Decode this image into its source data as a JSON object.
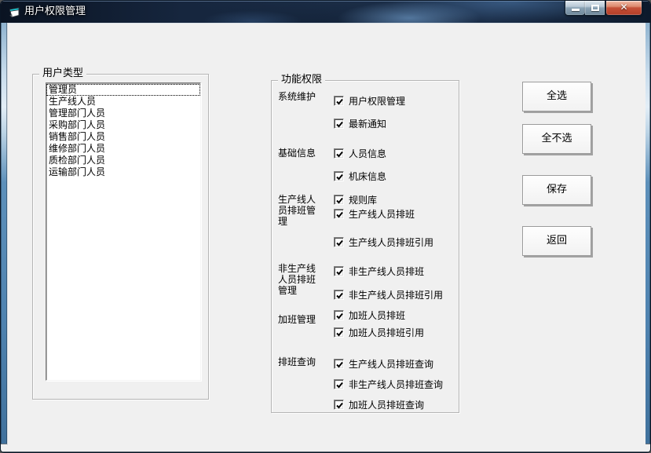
{
  "window": {
    "title": "用户权限管理"
  },
  "icons": {
    "close_glyph": "✕"
  },
  "colors": {
    "titlebar": "#1c2f4a",
    "frame_blue": "#5d90ba",
    "client_bg": "#f0f0f0",
    "close_button_red": "#c65138"
  },
  "user_types": {
    "group_label": "用户类型",
    "selected_index": 0,
    "items": [
      "管理员",
      "生产线人员",
      "管理部门人员",
      "采购部门人员",
      "销售部门人员",
      "维修部门人员",
      "质检部门人员",
      "运输部门人员"
    ]
  },
  "permissions": {
    "group_label": "功能权限",
    "sections": [
      {
        "label": "系统维护",
        "items": [
          {
            "label": "用户权限管理",
            "checked": true
          },
          {
            "label": "最新通知",
            "checked": true
          }
        ]
      },
      {
        "label": "基础信息",
        "items": [
          {
            "label": "人员信息",
            "checked": true
          },
          {
            "label": "机床信息",
            "checked": true
          }
        ]
      },
      {
        "label": "生产线人员排班管理",
        "items": [
          {
            "label": "规则库",
            "checked": true
          },
          {
            "label": "生产线人员排班",
            "checked": true
          },
          {
            "label": "生产线人员排班引用",
            "checked": true
          }
        ]
      },
      {
        "label": "非生产线人员排班管理",
        "items": [
          {
            "label": "非生产线人员排班",
            "checked": true
          },
          {
            "label": "非生产线人员排班引用",
            "checked": true
          }
        ]
      },
      {
        "label": "加班管理",
        "items": [
          {
            "label": "加班人员排班",
            "checked": true
          },
          {
            "label": "加班人员排班引用",
            "checked": true
          }
        ]
      },
      {
        "label": "排班查询",
        "items": [
          {
            "label": "生产线人员排班查询",
            "checked": true
          },
          {
            "label": "非生产线人员排班查询",
            "checked": true
          },
          {
            "label": "加班人员排班查询",
            "checked": true
          }
        ]
      }
    ]
  },
  "action_buttons": [
    {
      "label": "全选"
    },
    {
      "label": "全不选"
    },
    {
      "label": "保存"
    },
    {
      "label": "返回"
    }
  ]
}
